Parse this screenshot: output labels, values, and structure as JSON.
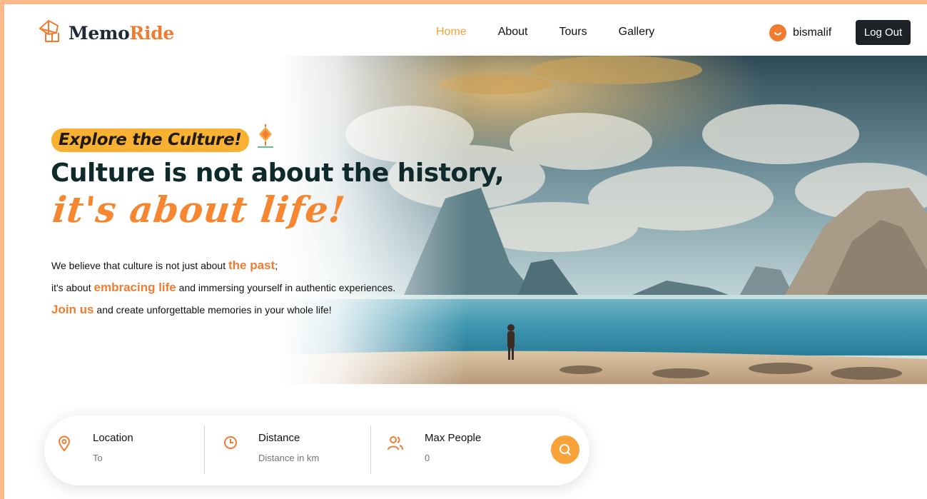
{
  "brand": {
    "prefix": "Memo",
    "accent": "Ride",
    "icon": "gift-box-icon"
  },
  "nav": {
    "links": [
      "Home",
      "About",
      "Tours",
      "Gallery"
    ],
    "active": "Home"
  },
  "user": {
    "name": "bismalif",
    "logout_label": "Log Out"
  },
  "hero": {
    "badge": "Explore the Culture!",
    "headline": "Culture is not about the history,",
    "script": "it's about life!",
    "line1_a": "We believe that culture is not just about ",
    "line1_hl": "the past",
    "line1_b": ";",
    "line2_a": "it's about ",
    "line2_hl": "embracing life",
    "line2_b": " and immersing yourself in authentic experiences.",
    "line3_hl": "Join us",
    "line3_b": " and create unforgettable memories in your whole life!"
  },
  "search": {
    "location": {
      "label": "Location",
      "placeholder": "To"
    },
    "distance": {
      "label": "Distance",
      "placeholder": "Distance in km"
    },
    "people": {
      "label": "Max People",
      "placeholder": "0"
    }
  },
  "colors": {
    "accent": "#f07c32",
    "accent_light": "#f8a23a",
    "dark": "#1e2226",
    "page_border": "#fdb98a"
  }
}
